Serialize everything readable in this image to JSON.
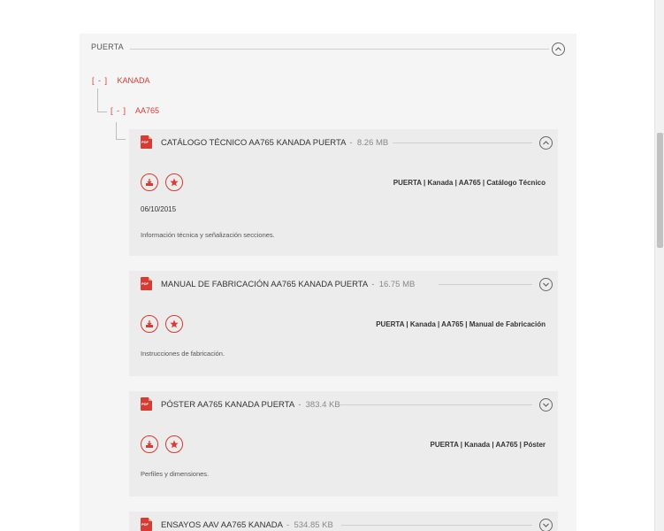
{
  "section": {
    "title": "PUERTA"
  },
  "tree": [
    {
      "toggle": "[ - ]",
      "label": "KANADA"
    },
    {
      "toggle": "[ - ]",
      "label": "AA765"
    }
  ],
  "documents": [
    {
      "title": "CATÁLOGO TÉCNICO AA765 KANADA PUERTA",
      "size": "8.26 MB",
      "expanded": true,
      "tags": "PUERTA | Kanada | AA765 | Catálogo Técnico",
      "date": "06/10/2015",
      "description": "Información técnica y señalización secciones."
    },
    {
      "title": "MANUAL DE FABRICACIÓN AA765 KANADA PUERTA",
      "size": "16.75 MB",
      "expanded": false,
      "tags": "PUERTA | Kanada | AA765 | Manual de Fabricación",
      "description": "Instrucciones de fabricación."
    },
    {
      "title": "PÓSTER AA765 KANADA PUERTA",
      "size": "383.4 KB",
      "expanded": false,
      "tags": "PUERTA | Kanada | AA765 | Póster",
      "description": "Perfiles y dimensiones."
    },
    {
      "title": "ENSAYOS AAV AA765 KANADA",
      "size": "534.85 KB",
      "expanded": false
    }
  ],
  "icons": {
    "pdf_label": "PDF",
    "file": "pdf-file-icon",
    "download": "download-icon",
    "favorite": "star-icon",
    "collapse": "chevron-up-icon",
    "expand": "chevron-down-icon"
  },
  "colors": {
    "accent": "#d63b34",
    "panel": "#f5f5f5",
    "card": "#ececec",
    "text": "#333333",
    "muted": "#888888"
  }
}
